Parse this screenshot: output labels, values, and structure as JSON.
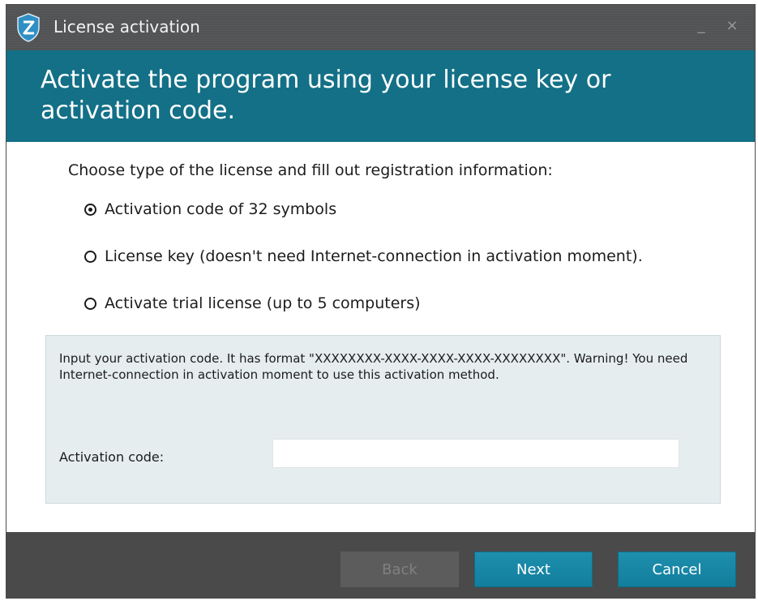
{
  "window": {
    "title": "License activation",
    "minimize_glyph": "_",
    "close_glyph": "×"
  },
  "banner": {
    "text": "Activate the program using your license key or activation code."
  },
  "content": {
    "instruction": "Choose type of the license and fill out registration information:",
    "options": [
      {
        "label": "Activation code of 32 symbols",
        "checked": true
      },
      {
        "label": "License key (doesn't need Internet-connection in activation moment).",
        "checked": false
      },
      {
        "label": "Activate trial license (up to 5 computers)",
        "checked": false
      }
    ]
  },
  "panel": {
    "info": "Input your activation code. It has format \"XXXXXXXX-XXXX-XXXX-XXXX-XXXXXXXX\". Warning! You need Internet-connection in activation moment to use this activation method.",
    "code_label": "Activation code:",
    "code_value": ""
  },
  "footer": {
    "back_label": "Back",
    "next_label": "Next",
    "cancel_label": "Cancel"
  },
  "colors": {
    "banner": "#137087",
    "titlebar": "#525354",
    "footer": "#4a4a4b",
    "panel": "#e5edef",
    "accent_button": "#1589a8"
  },
  "icons": {
    "app_logo": "shield-z-logo-icon"
  }
}
